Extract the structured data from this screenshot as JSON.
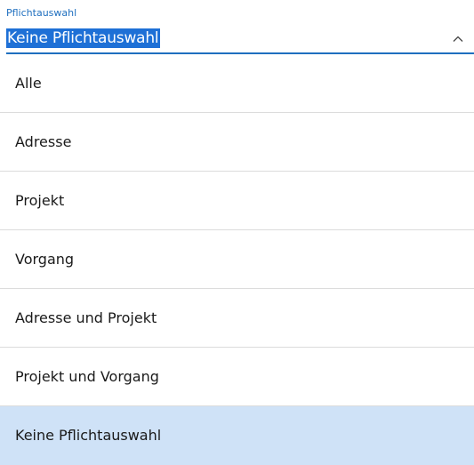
{
  "field": {
    "label": "Pflichtauswahl",
    "value": "Keine Pflichtauswahl",
    "chevron_icon": "chevron-up-icon"
  },
  "options": [
    {
      "label": "Alle"
    },
    {
      "label": "Adresse"
    },
    {
      "label": "Projekt"
    },
    {
      "label": "Vorgang"
    },
    {
      "label": "Adresse und Projekt"
    },
    {
      "label": "Projekt und Vorgang"
    },
    {
      "label": "Keine Pflichtauswahl",
      "selected": true
    }
  ],
  "colors": {
    "accent": "#1f6fbf",
    "selection_highlight": "#1e70d6",
    "selected_row_bg": "#cfe2f7",
    "divider": "#dcdcdc"
  }
}
